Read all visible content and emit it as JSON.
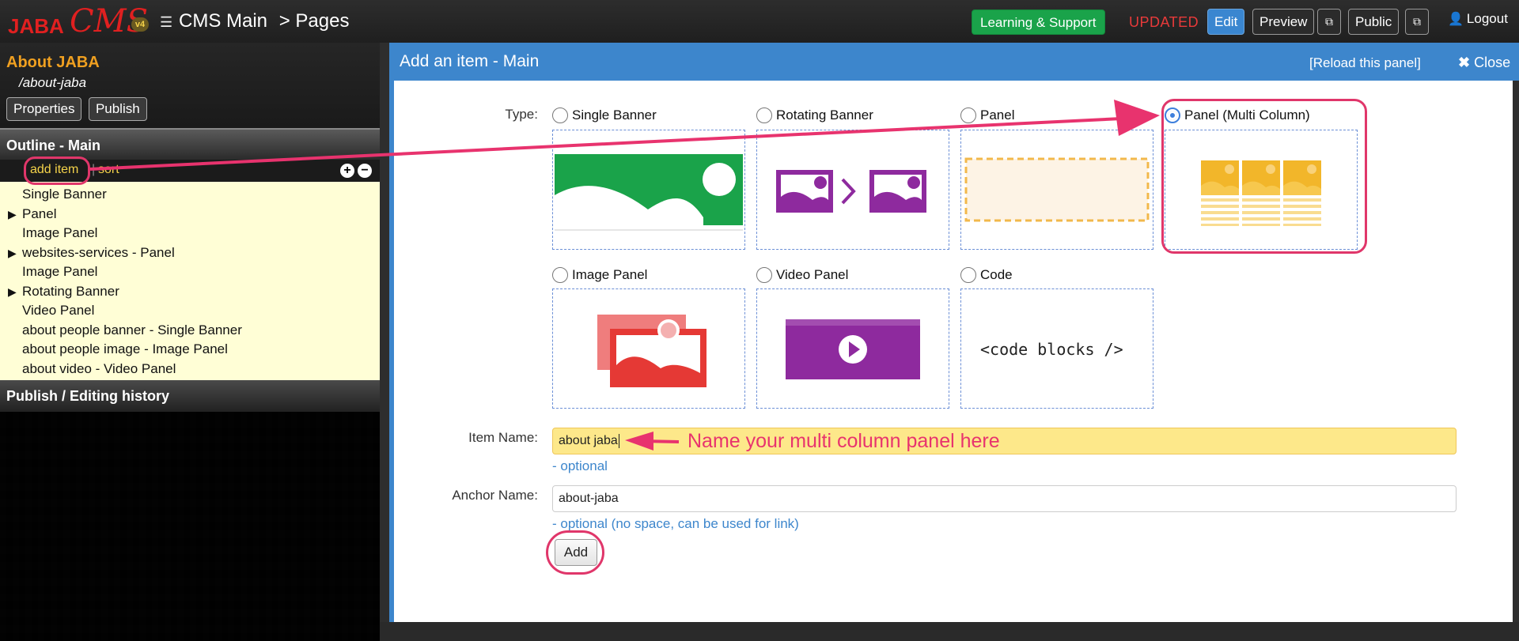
{
  "topbar": {
    "logo_jaba": "JABA",
    "logo_cms": "CMS",
    "logo_version": "v4",
    "breadcrumb_site": "CMS Main",
    "breadcrumb_section": "> Pages",
    "learning_label": "Learning & Support",
    "status_label": "UPDATED",
    "edit_label": "Edit",
    "preview_label": "Preview",
    "public_label": "Public",
    "logout_label": "Logout"
  },
  "sidebar": {
    "page_title": "About JABA",
    "page_path": "/about-jaba",
    "properties_label": "Properties",
    "publish_label": "Publish",
    "outline_title": "Outline - Main",
    "add_item_label": "add item",
    "sort_label": "sort",
    "outline_items": [
      {
        "label": "Single Banner",
        "expandable": false
      },
      {
        "label": "Panel",
        "expandable": true
      },
      {
        "label": "Image Panel",
        "expandable": false
      },
      {
        "label": "websites-services - Panel",
        "expandable": true
      },
      {
        "label": "Image Panel",
        "expandable": false
      },
      {
        "label": "Rotating Banner",
        "expandable": true
      },
      {
        "label": "Video Panel",
        "expandable": false
      },
      {
        "label": "about people banner - Single Banner",
        "expandable": false
      },
      {
        "label": "about people image - Image Panel",
        "expandable": false
      },
      {
        "label": "about video - Video Panel",
        "expandable": false
      }
    ],
    "history_title": "Publish / Editing history"
  },
  "panel": {
    "title": "Add an item - Main",
    "reload_label": "[Reload this panel]",
    "close_label": "Close",
    "type_label": "Type:",
    "types": {
      "single_banner": "Single Banner",
      "rotating_banner": "Rotating Banner",
      "panel": "Panel",
      "panel_multi": "Panel (Multi Column)",
      "image_panel": "Image Panel",
      "video_panel": "Video Panel",
      "code": "Code"
    },
    "selected_type": "Panel (Multi Column)",
    "code_thumb_text": "<code blocks />",
    "item_name_label": "Item Name:",
    "item_name_value": "about jaba",
    "item_name_hint": "- optional",
    "anchor_name_label": "Anchor Name:",
    "anchor_name_value": "about-jaba",
    "anchor_name_hint": "- optional (no space, can be used for link)",
    "add_label": "Add"
  },
  "annotation": {
    "text": "Name your multi column panel here",
    "color": "#e8336e"
  },
  "colors": {
    "accent_blue": "#3d86cc",
    "learning_green": "#1aa34a",
    "updated_red": "#e83a3a",
    "highlight_pink": "#e0366a",
    "sidebar_title_orange": "#f0a020"
  }
}
